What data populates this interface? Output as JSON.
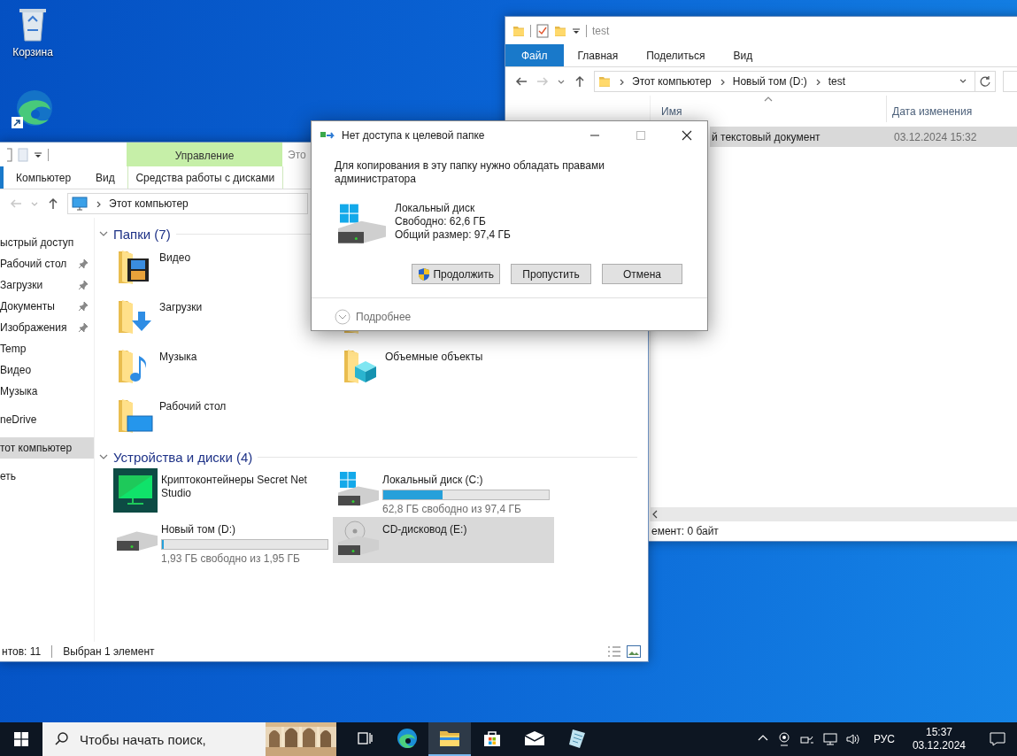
{
  "desktop_icons": [
    {
      "kind": "recycle-bin",
      "label": "Корзина"
    },
    {
      "kind": "browser"
    }
  ],
  "right_window": {
    "title": "test",
    "tabs": [
      {
        "label": "Файл",
        "kind": "file",
        "selected": false
      },
      {
        "label": "Главная",
        "kind": "tab",
        "selected": false
      },
      {
        "label": "Поделиться",
        "kind": "tab",
        "selected": false
      },
      {
        "label": "Вид",
        "kind": "tab",
        "selected": false
      }
    ],
    "breadcrumbs": [
      "Этот компьютер",
      "Новый том (D:)",
      "test"
    ],
    "columns": [
      {
        "label": "Имя",
        "sorted": true
      },
      {
        "label": "Дата изменения",
        "sorted": false
      }
    ],
    "rows": [
      {
        "name": "й текстовый документ",
        "date": "03.12.2024 15:32",
        "selected": true
      }
    ],
    "status": "емент: 0 байт"
  },
  "left_window": {
    "context_group": "Управление",
    "title": "Это",
    "tabs": [
      {
        "label": "Компьютер",
        "kind": "tab",
        "selected": false
      },
      {
        "label": "Вид",
        "kind": "tab",
        "selected": false
      },
      {
        "label": "Средства работы с дисками",
        "kind": "context",
        "selected": false
      }
    ],
    "breadcrumbs": [
      "Этот компьютер"
    ],
    "nav": [
      {
        "label": "ыстрый доступ",
        "selected": false,
        "children": [
          {
            "label": "Рабочий стол",
            "pinned": true,
            "selected": false
          },
          {
            "label": "Загрузки",
            "pinned": true,
            "selected": false
          },
          {
            "label": "Документы",
            "pinned": true,
            "selected": false
          },
          {
            "label": "Изображения",
            "pinned": true,
            "selected": false
          },
          {
            "label": "Temp",
            "pinned": false,
            "selected": false
          },
          {
            "label": "Видео",
            "pinned": false,
            "selected": false
          },
          {
            "label": "Музыка",
            "pinned": false,
            "selected": false
          }
        ]
      },
      {
        "label": "neDrive",
        "selected": false
      },
      {
        "label": "тот компьютер",
        "selected": true
      },
      {
        "label": "еть",
        "selected": false
      }
    ],
    "folders": {
      "title": "Папки (7)",
      "expanded": true,
      "items": [
        {
          "label": "Видео",
          "kind": "video"
        },
        {
          "label": "Загрузки",
          "kind": "downloads"
        },
        {
          "label": "Музыка",
          "kind": "music"
        },
        {
          "label": "Рабочий стол",
          "kind": "desktop"
        }
      ],
      "items_right": [
        {
          "kind": "images"
        },
        {
          "label": "Объемные объекты",
          "kind": "cube"
        }
      ]
    },
    "drives": {
      "title": "Устройства и диски (4)",
      "expanded": true,
      "items": [
        {
          "label": "Криптоконтейнеры Secret Net Studio",
          "kind": "app",
          "selected": false
        },
        {
          "label": "Локальный диск (C:)",
          "kind": "system",
          "level": 0.36,
          "free": "62,8 ГБ свободно из 97,4 ГБ",
          "selected": false
        },
        {
          "label": "Новый том (D:)",
          "kind": "disk",
          "level": 0.01,
          "free": "1,93 ГБ свободно из 1,95 ГБ",
          "selected": false
        },
        {
          "label": "CD-дисковод (E:)",
          "kind": "cd",
          "selected": true
        }
      ]
    },
    "status": [
      "нтов: 11",
      "Выбран 1 элемент"
    ]
  },
  "dialog": {
    "title": "Нет доступа к целевой папке",
    "message": "Для копирования в эту папку нужно обладать правами администратора",
    "drive": {
      "name": "Локальный диск",
      "free": "Свободно: 62,6 ГБ",
      "total": "Общий размер: 97,4 ГБ"
    },
    "buttons": [
      {
        "label": "Продолжить",
        "kind": "elevated"
      },
      {
        "label": "Пропустить",
        "kind": "plain"
      },
      {
        "label": "Отмена",
        "kind": "plain"
      }
    ],
    "details": {
      "label": "Подробнее",
      "expanded": false
    }
  },
  "taskbar": {
    "search_placeholder": "Чтобы начать поиск,",
    "apps": [
      {
        "kind": "task-view",
        "active": false
      },
      {
        "kind": "browser",
        "active": false
      },
      {
        "kind": "explorer",
        "active": true
      },
      {
        "kind": "store",
        "active": false
      },
      {
        "kind": "mail",
        "active": false
      },
      {
        "kind": "notes",
        "active": false
      }
    ],
    "language": "РУС",
    "time": "15:37",
    "date": "03.12.2024"
  }
}
